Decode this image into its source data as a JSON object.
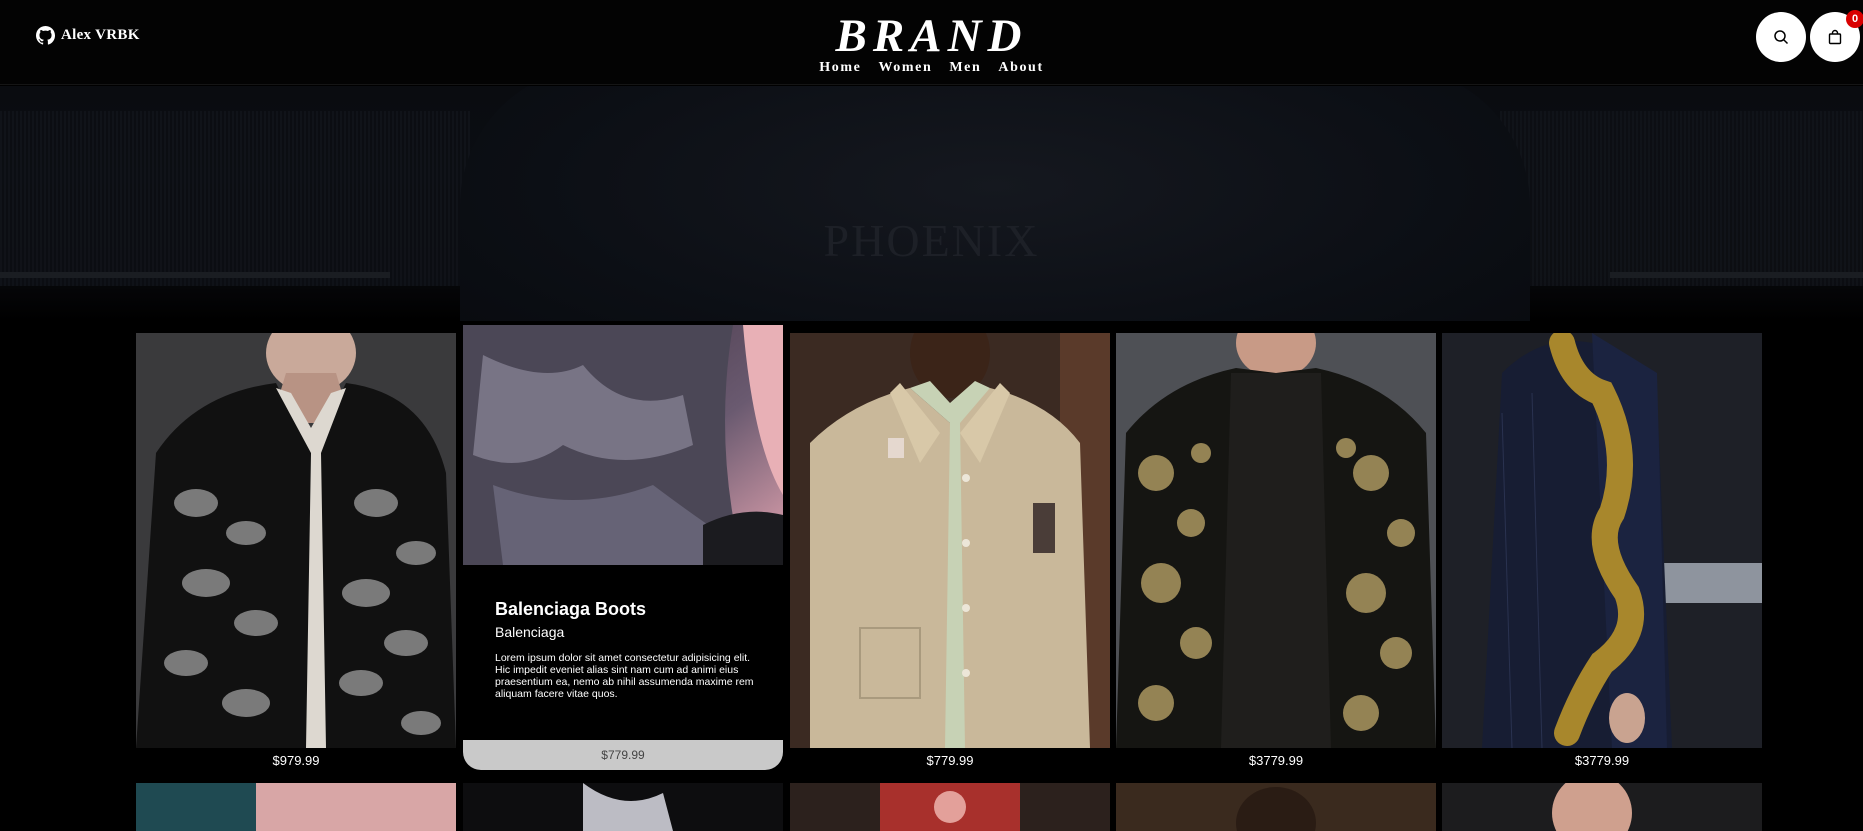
{
  "header": {
    "github_user": "Alex VRBK",
    "brand": "BRAND",
    "nav": [
      "Home",
      "Women",
      "Men",
      "About"
    ],
    "cart_count": "0",
    "icons": {
      "github": "github-icon",
      "search": "search-icon",
      "cart": "shopping-bag-icon"
    }
  },
  "hero": {
    "text": "PHOENIX"
  },
  "products": [
    {
      "price": "$979.99"
    },
    {
      "title": "Balenciaga Boots",
      "brand": "Balenciaga",
      "description": "Lorem ipsum dolor sit amet consectetur adipisicing elit. Hic impedit eveniet alias sint nam cum ad animi eius praesentium ea, nemo ab nihil assumenda maxime rem aliquam facere vitae quos.",
      "price": "$779.99"
    },
    {
      "price": "$779.99"
    },
    {
      "price": "$3779.99"
    },
    {
      "price": "$3779.99"
    }
  ],
  "colors": {
    "background": "#000000",
    "badge": "#d90000",
    "price_bar": "#c9c9c9"
  }
}
